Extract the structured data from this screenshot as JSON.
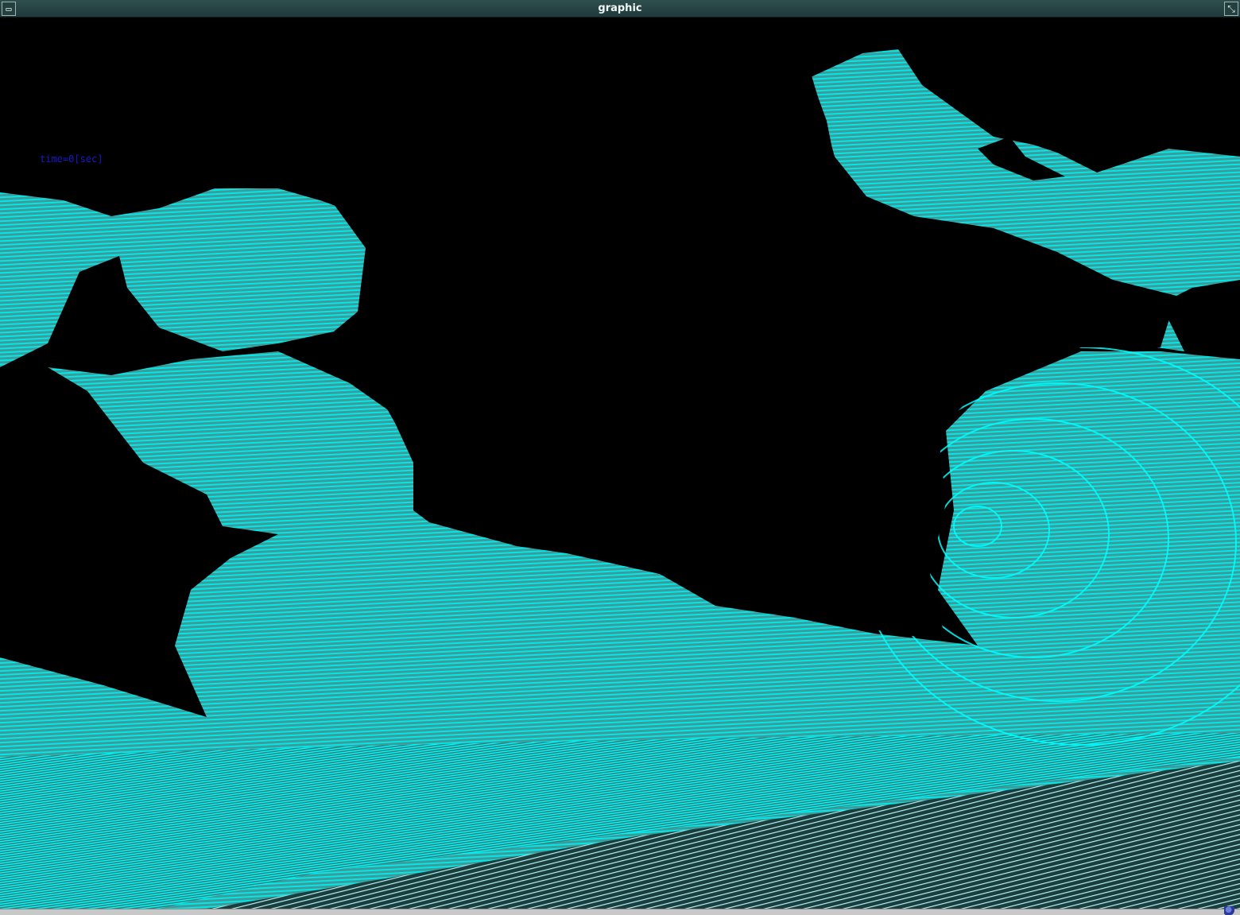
{
  "window": {
    "title": "graphic",
    "menu_glyph": "▭",
    "close_glyph": "⤡"
  },
  "plot": {
    "time_label": "time=0[sec]",
    "colors": {
      "background": "#000000",
      "contour": "#00ffff",
      "fill": "#4aa6a6",
      "label": "#1a18c9"
    }
  },
  "icons": {
    "window_menu": "window-menu-icon",
    "maximize": "resize-icon",
    "tray": "tray-app-icon"
  }
}
